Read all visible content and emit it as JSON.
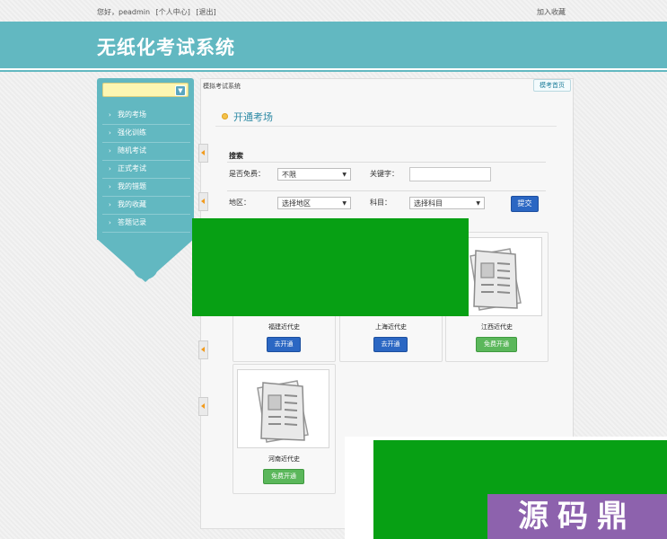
{
  "topbar": {
    "greeting": "您好，peadmin",
    "personal_center": "[个人中心]",
    "logout": "[退出]",
    "favorite": "加入收藏"
  },
  "banner": {
    "title": "无纸化考试系统"
  },
  "sidebar": {
    "select_value": "",
    "items": [
      {
        "label": "我的考场"
      },
      {
        "label": "强化训练"
      },
      {
        "label": "随机考试"
      },
      {
        "label": "正式考试"
      },
      {
        "label": "我的错题"
      },
      {
        "label": "我的收藏"
      },
      {
        "label": "答题记录"
      }
    ]
  },
  "breadcrumb": "模拟考试系统",
  "home_button": "模考首页",
  "section": {
    "title": "开通考场"
  },
  "search": {
    "heading": "搜索",
    "free_label": "是否免费：",
    "free_value": "不限",
    "keyword_label": "关键字：",
    "keyword_value": "",
    "region_label": "地区：",
    "region_value": "选择地区",
    "subject_label": "科目：",
    "subject_value": "选择科目",
    "submit_label": "提交"
  },
  "cards": [
    {
      "name": "福建近代史",
      "button": "去开通",
      "button_type": "blue"
    },
    {
      "name": "上海近代史",
      "button": "去开通",
      "button_type": "blue"
    },
    {
      "name": "江西近代史",
      "button": "免费开通",
      "button_type": "green"
    },
    {
      "name": "河南近代史",
      "button": "免费开通",
      "button_type": "green"
    }
  ],
  "watermark": "源码鼎",
  "colors": {
    "banner": "#62b8c1",
    "accent_text": "#2d8aa5",
    "button_blue": "#2b67c3",
    "button_green": "#5bb75b",
    "occluder_green": "#07a014",
    "watermark_bg": "#8d62ad"
  }
}
